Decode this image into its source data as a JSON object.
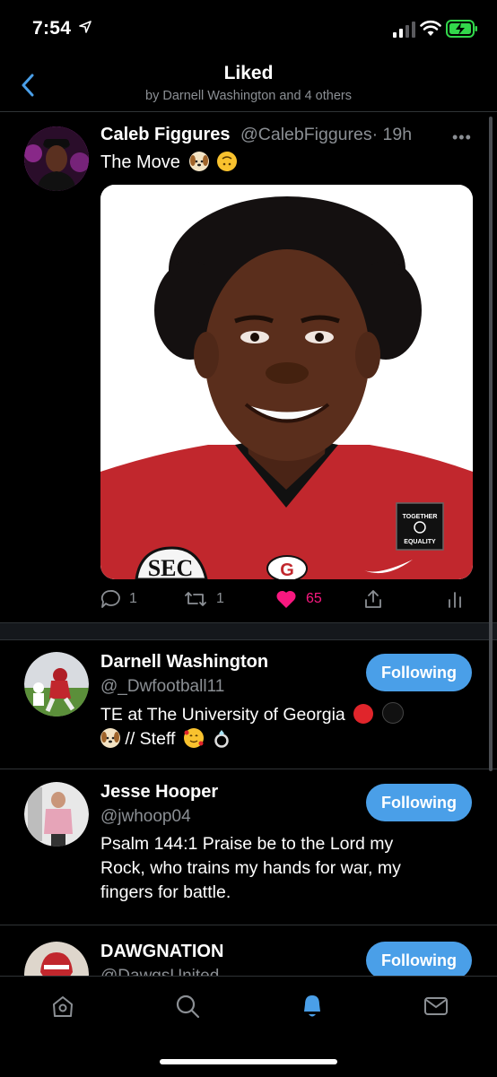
{
  "status": {
    "time": "7:54"
  },
  "header": {
    "title": "Liked",
    "subtitle": "by Darnell Washington and 4 others"
  },
  "tweet": {
    "name": "Caleb Figgures",
    "handle": "@CalebFiggures",
    "time": "· 19h",
    "text": "The Move",
    "replies": "1",
    "retweets": "1",
    "likes": "65",
    "media_patch_text_1": "TOGETHER",
    "media_patch_text_2": "EQUALITY",
    "media_logo_text": "SEC",
    "colors": {
      "like": "#f91880",
      "jersey": "#c1272d",
      "accent": "#4a9fe8"
    }
  },
  "users": [
    {
      "name": "Darnell Washington",
      "handle": "@_Dwfootball11",
      "bio_line1": "TE at The University of Georgia",
      "bio_line2": "// Steff",
      "follow_label": "Following"
    },
    {
      "name": "Jesse Hooper",
      "handle": "@jwhoop04",
      "bio": "Psalm 144:1 Praise be to the Lord my Rock, who trains my hands for war, my fingers for battle.",
      "follow_label": "Following"
    },
    {
      "name": "DAWGNATION",
      "handle": "@DawgsUnited",
      "follow_label": "Following"
    }
  ],
  "tabs": [
    "home-icon",
    "search-icon",
    "notifications-icon",
    "messages-icon"
  ]
}
